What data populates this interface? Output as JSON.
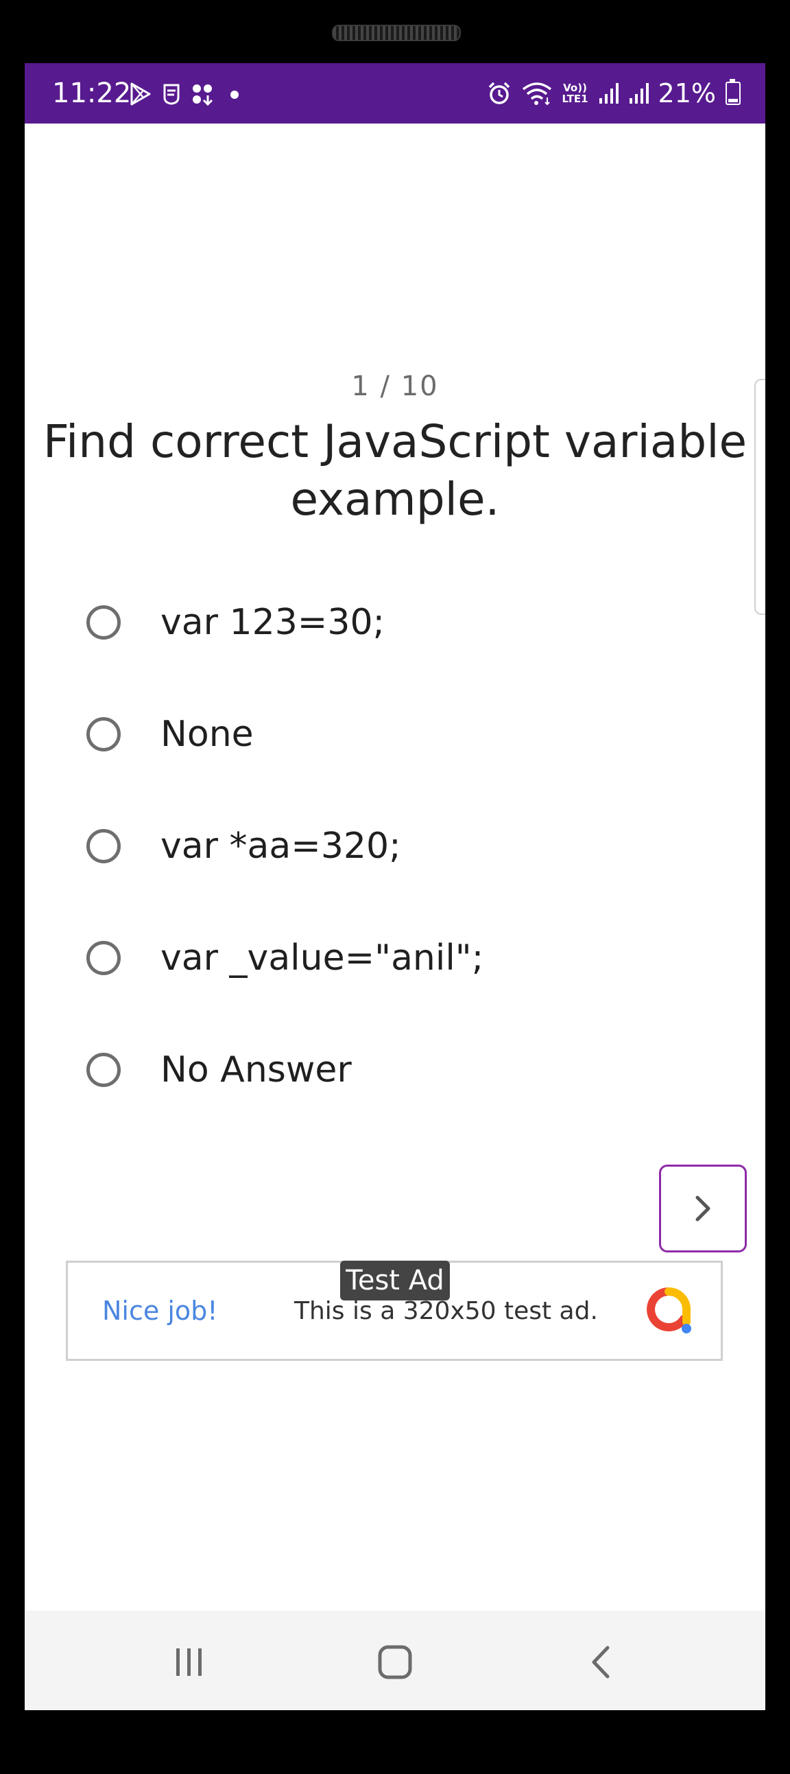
{
  "status_bar": {
    "time": "11:22",
    "battery": "21%",
    "battery_level": 0.21,
    "left_icons": [
      "play-store-icon",
      "mask-icon",
      "apps-icon",
      "dot-icon"
    ],
    "right_icons": [
      "alarm-icon",
      "wifi-icon",
      "volte-icon",
      "signal-icon",
      "signal-icon",
      "battery-icon"
    ],
    "volte_label": "Vo)) LTE1"
  },
  "quiz": {
    "counter": "1 / 10",
    "question": "Find correct JavaScript variable example.",
    "options": [
      {
        "label": "var 123=30;",
        "selected": false
      },
      {
        "label": "None",
        "selected": false
      },
      {
        "label": "var *aa=320;",
        "selected": false
      },
      {
        "label": "var _value=\"anil\";",
        "selected": false
      },
      {
        "label": "No Answer",
        "selected": false
      }
    ],
    "next_icon": "chevron-right-icon"
  },
  "ad": {
    "label": "Test Ad",
    "headline": "Nice job!",
    "text": "This is a 320x50 test ad."
  },
  "colors": {
    "status_bar": "#571a8f",
    "next_button_border": "#8e2aa8",
    "ad_headline": "#4a86e0"
  },
  "navigation": {
    "buttons": [
      "recent-apps-icon",
      "home-icon",
      "back-icon"
    ]
  }
}
